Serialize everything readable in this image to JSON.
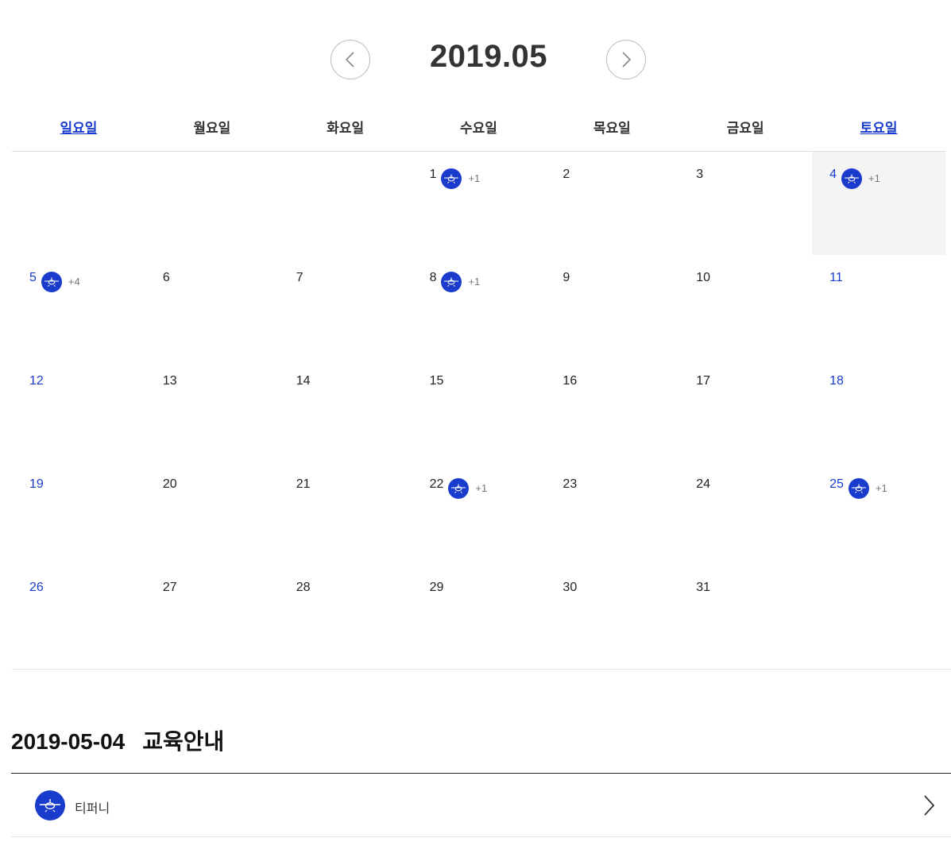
{
  "calendar": {
    "title": "2019.05",
    "weekdays": [
      "일요일",
      "월요일",
      "화요일",
      "수요일",
      "목요일",
      "금요일",
      "토요일"
    ],
    "selected_day": "4",
    "days": [
      {
        "day": "",
        "badge": false,
        "more": ""
      },
      {
        "day": "",
        "badge": false,
        "more": ""
      },
      {
        "day": "",
        "badge": false,
        "more": ""
      },
      {
        "day": "1",
        "badge": true,
        "more": "+1"
      },
      {
        "day": "2",
        "badge": false,
        "more": ""
      },
      {
        "day": "3",
        "badge": false,
        "more": ""
      },
      {
        "day": "4",
        "badge": true,
        "more": "+1"
      },
      {
        "day": "5",
        "badge": true,
        "more": "+4"
      },
      {
        "day": "6",
        "badge": false,
        "more": ""
      },
      {
        "day": "7",
        "badge": false,
        "more": ""
      },
      {
        "day": "8",
        "badge": true,
        "more": "+1"
      },
      {
        "day": "9",
        "badge": false,
        "more": ""
      },
      {
        "day": "10",
        "badge": false,
        "more": ""
      },
      {
        "day": "11",
        "badge": false,
        "more": ""
      },
      {
        "day": "12",
        "badge": false,
        "more": ""
      },
      {
        "day": "13",
        "badge": false,
        "more": ""
      },
      {
        "day": "14",
        "badge": false,
        "more": ""
      },
      {
        "day": "15",
        "badge": false,
        "more": ""
      },
      {
        "day": "16",
        "badge": false,
        "more": ""
      },
      {
        "day": "17",
        "badge": false,
        "more": ""
      },
      {
        "day": "18",
        "badge": false,
        "more": ""
      },
      {
        "day": "19",
        "badge": false,
        "more": ""
      },
      {
        "day": "20",
        "badge": false,
        "more": ""
      },
      {
        "day": "21",
        "badge": false,
        "more": ""
      },
      {
        "day": "22",
        "badge": true,
        "more": "+1"
      },
      {
        "day": "23",
        "badge": false,
        "more": ""
      },
      {
        "day": "24",
        "badge": false,
        "more": ""
      },
      {
        "day": "25",
        "badge": true,
        "more": "+1"
      },
      {
        "day": "26",
        "badge": false,
        "more": ""
      },
      {
        "day": "27",
        "badge": false,
        "more": ""
      },
      {
        "day": "28",
        "badge": false,
        "more": ""
      },
      {
        "day": "29",
        "badge": false,
        "more": ""
      },
      {
        "day": "30",
        "badge": false,
        "more": ""
      },
      {
        "day": "31",
        "badge": false,
        "more": ""
      },
      {
        "day": "",
        "badge": false,
        "more": ""
      }
    ]
  },
  "detail": {
    "date": "2019-05-04",
    "heading": "교육안내",
    "items": [
      {
        "name": "티퍼니",
        "icon": "airplane-icon"
      }
    ]
  },
  "icons": {
    "prev": "chevron-left-icon",
    "next": "chevron-right-icon",
    "event": "airplane-icon",
    "item_arrow": "chevron-right-icon"
  },
  "colors": {
    "accent": "#1a3ccc",
    "selected_bg": "#f4f4f4",
    "text": "#222222",
    "muted": "#777777"
  }
}
